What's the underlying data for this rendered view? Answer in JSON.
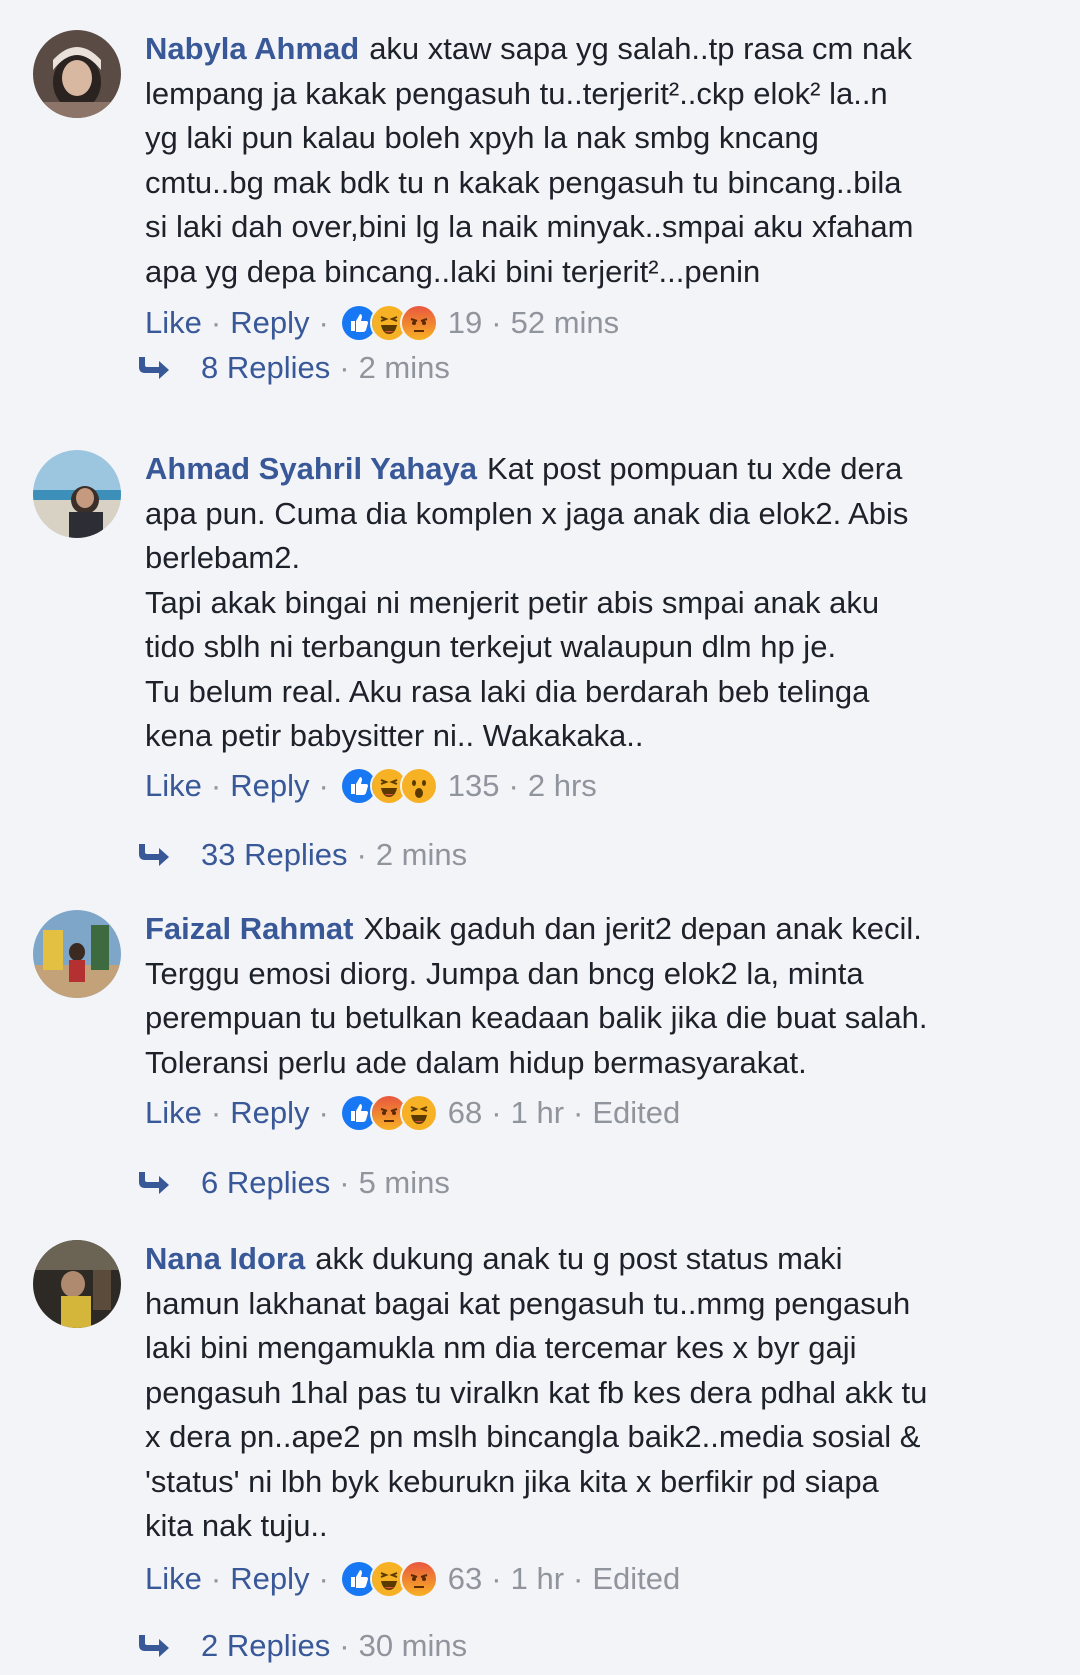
{
  "comments": [
    {
      "author": "Nabyla Ahmad",
      "lines": [
        "aku xtaw sapa yg salah..tp rasa cm nak",
        "lempang ja kakak pengasuh tu..terjerit²..ckp elok² la..n",
        "yg laki pun kalau boleh xpyh la nak smbg kncang",
        "cmtu..bg mak bdk tu n kakak pengasuh tu bincang..bila",
        "si laki dah over,bini lg la naik minyak..smpai aku xfaham",
        "apa yg depa bincang..laki bini terjerit²...penin"
      ],
      "like_label": "Like",
      "reply_label": "Reply",
      "reactions": [
        "like-icon",
        "haha-icon",
        "angry-icon"
      ],
      "reaction_count": "19",
      "time": "52 mins",
      "edited": "",
      "replies_label": "8 Replies",
      "replies_time": "2 mins"
    },
    {
      "author": "Ahmad Syahril Yahaya",
      "lines": [
        "Kat post pompuan tu xde dera",
        "apa pun. Cuma dia komplen x jaga anak dia elok2. Abis",
        "berlebam2.",
        "Tapi akak bingai ni menjerit petir abis smpai anak aku",
        "tido sblh ni terbangun terkejut walaupun dlm hp je.",
        "Tu belum real. Aku rasa laki dia berdarah beb telinga",
        "kena petir babysitter ni.. Wakakaka.."
      ],
      "like_label": "Like",
      "reply_label": "Reply",
      "reactions": [
        "like-icon",
        "haha-icon",
        "wow-icon"
      ],
      "reaction_count": "135",
      "time": "2 hrs",
      "edited": "",
      "replies_label": "33 Replies",
      "replies_time": "2 mins"
    },
    {
      "author": "Faizal Rahmat",
      "lines": [
        "Xbaik gaduh dan jerit2 depan anak kecil.",
        "Terggu emosi diorg. Jumpa dan bncg elok2 la, minta",
        "perempuan tu betulkan keadaan balik jika die buat salah.",
        "Toleransi perlu ade dalam hidup bermasyarakat."
      ],
      "like_label": "Like",
      "reply_label": "Reply",
      "reactions": [
        "like-icon",
        "angry-icon",
        "haha-icon"
      ],
      "reaction_count": "68",
      "time": "1 hr",
      "edited": "Edited",
      "replies_label": "6 Replies",
      "replies_time": "5 mins"
    },
    {
      "author": "Nana Idora",
      "lines": [
        "akk dukung anak tu g post status maki",
        "hamun lakhanat bagai kat pengasuh tu..mmg pengasuh",
        "laki bini mengamukla nm dia tercemar kes x byr gaji",
        "pengasuh 1hal pas tu viralkn kat fb kes dera pdhal akk tu",
        "x dera pn..ape2 pn mslh bincangla baik2..media sosial &",
        "'status' ni lbh byk keburukn jika kita x berfikir pd siapa",
        "kita nak tuju.."
      ],
      "like_label": "Like",
      "reply_label": "Reply",
      "reactions": [
        "like-icon",
        "haha-icon",
        "angry-icon"
      ],
      "reaction_count": "63",
      "time": "1 hr",
      "edited": "Edited",
      "replies_label": "2 Replies",
      "replies_time": "30 mins"
    }
  ],
  "colors": {
    "link": "#385898",
    "meta": "#90949c",
    "text": "#1d2129",
    "background": "#f3f4f8",
    "like": "#1877f2",
    "haha": "#f7b125",
    "angry": "#e9573f"
  }
}
